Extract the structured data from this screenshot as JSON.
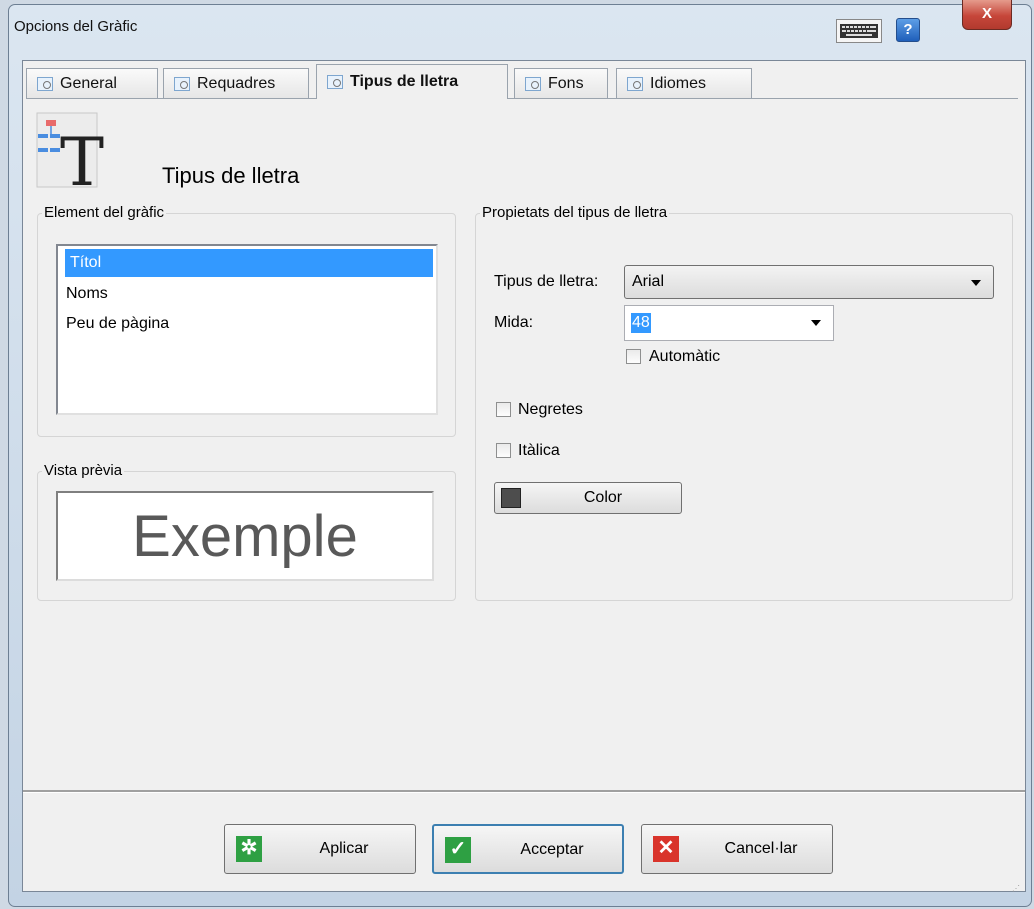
{
  "window": {
    "title": "Opcions del Gràfic",
    "help_label": "?",
    "close_label": "X"
  },
  "tabs": [
    {
      "label": "General"
    },
    {
      "label": "Requadres"
    },
    {
      "label": "Tipus de lletra"
    },
    {
      "label": "Fons"
    },
    {
      "label": "Idiomes"
    }
  ],
  "header": {
    "title": "Tipus de lletra",
    "icon_letter": "T"
  },
  "element_group": {
    "legend": "Element del gràfic",
    "items": [
      {
        "label": "Títol"
      },
      {
        "label": "Noms"
      },
      {
        "label": "Peu de pàgina"
      }
    ],
    "selected_index": 0
  },
  "preview_group": {
    "legend": "Vista prèvia",
    "sample_text": "Exemple"
  },
  "props_group": {
    "legend": "Propietats del tipus de lletra",
    "font_label": "Tipus de lletra:",
    "font_value": "Arial",
    "size_label": "Mida:",
    "size_value": "48",
    "auto_label": "Automàtic",
    "bold_label": "Negretes",
    "italic_label": "Itàlica",
    "color_button": "Color",
    "color_value": "#4d4d4d"
  },
  "footer": {
    "apply": "Aplicar",
    "accept": "Acceptar",
    "cancel": "Cancel·lar"
  }
}
